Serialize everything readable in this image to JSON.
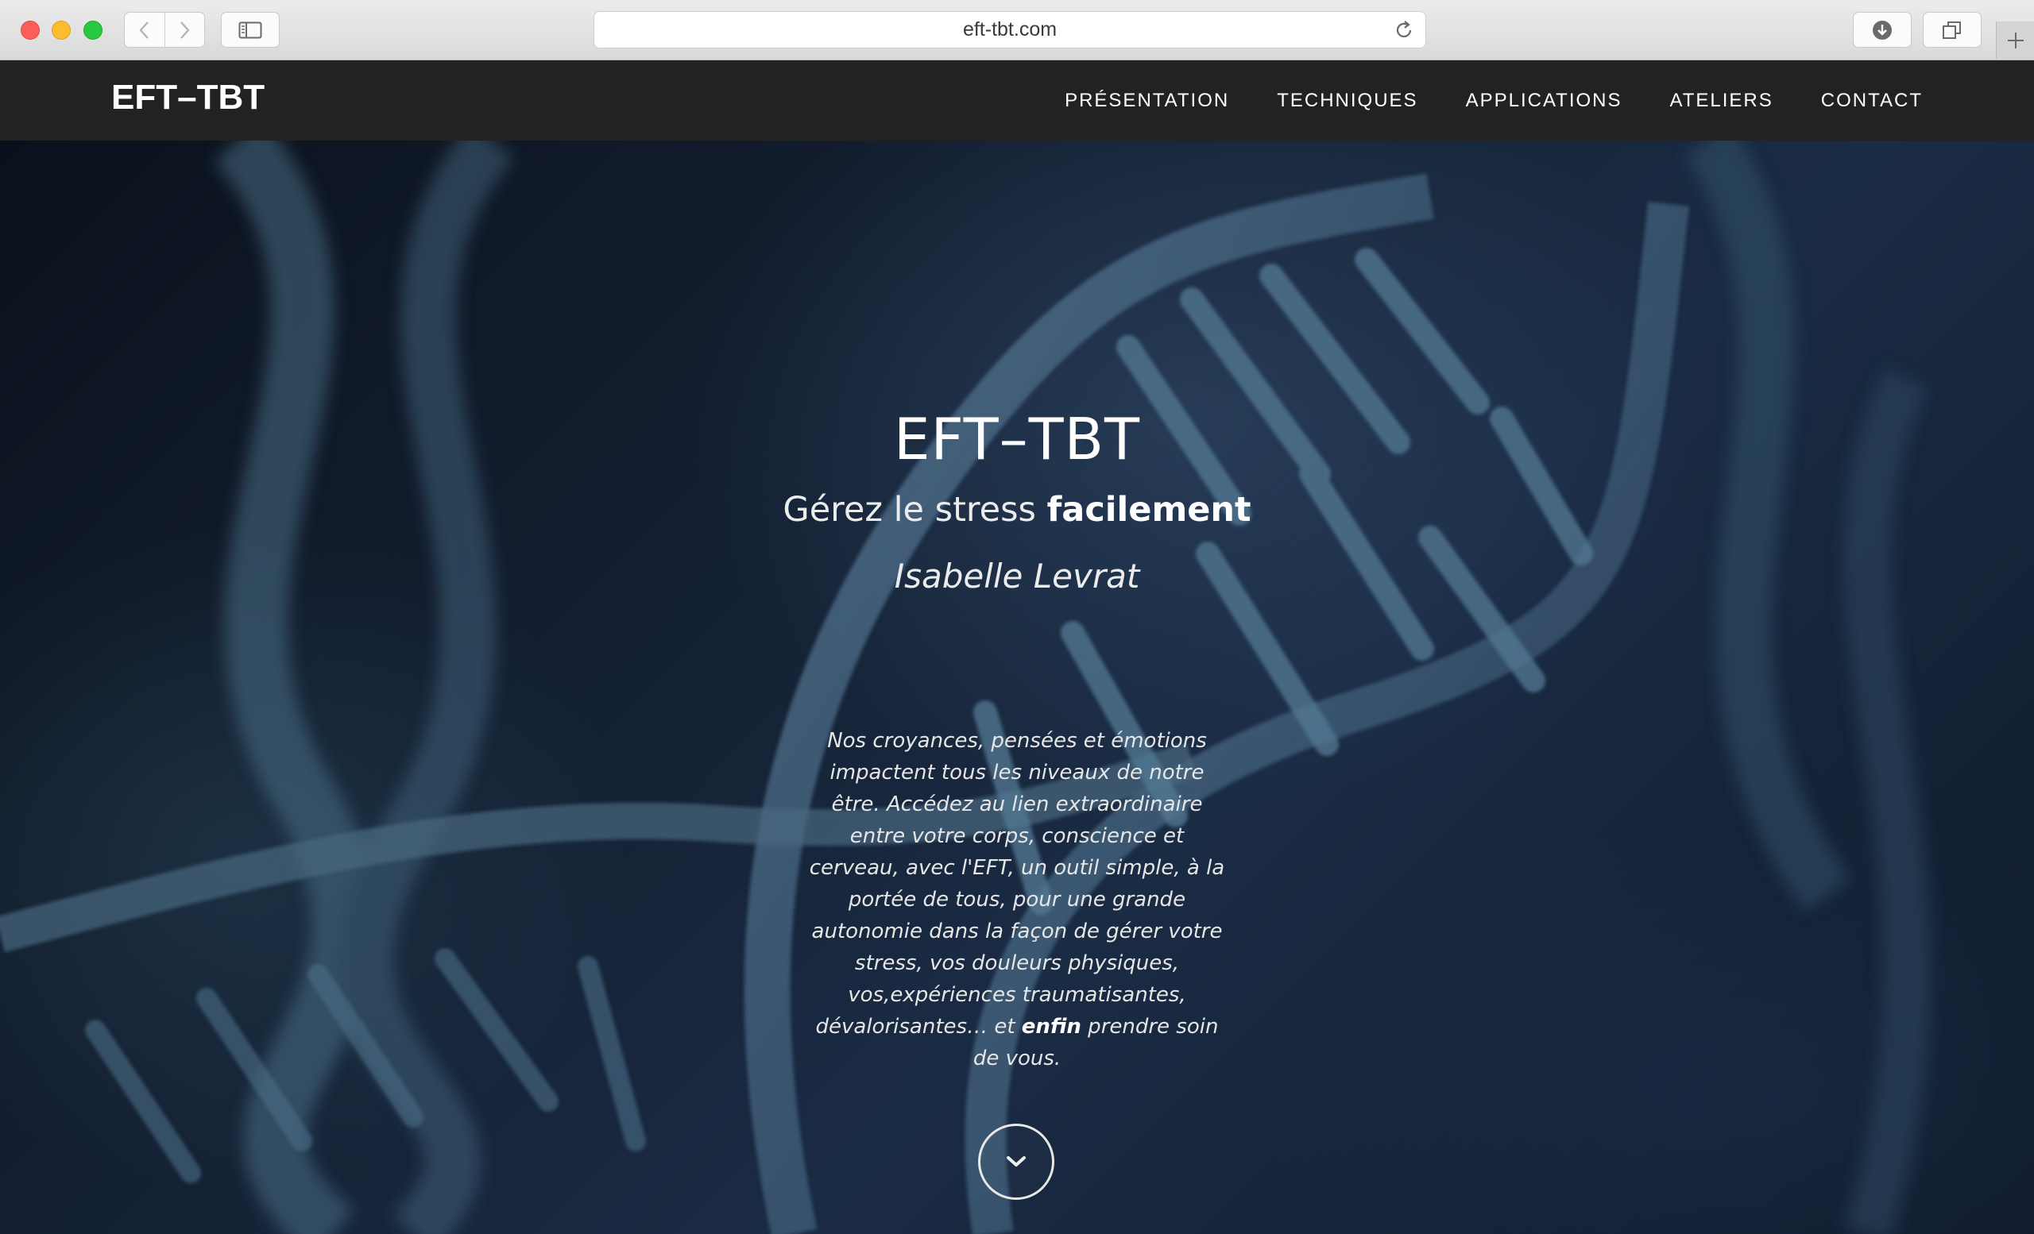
{
  "browser": {
    "url": "eft-tbt.com",
    "icons": {
      "back": "chevron-left-icon",
      "forward": "chevron-right-icon",
      "sidebar": "sidebar-icon",
      "reload": "reload-icon",
      "download": "download-icon",
      "tabs": "tabs-icon",
      "new_tab": "plus-icon"
    }
  },
  "site": {
    "brand": "EFT–TBT",
    "menu": [
      "PRÉSENTATION",
      "TECHNIQUES",
      "APPLICATIONS",
      "ATELIERS",
      "CONTACT"
    ]
  },
  "hero": {
    "title": "EFT–TBT",
    "subtitle_plain": "Gérez le stress ",
    "subtitle_bold": "facilement",
    "author": "Isabelle Levrat",
    "description_before": "Nos croyances, pensées et émotions impactent tous les niveaux de notre être. Accédez au lien extraordinaire entre votre corps, conscience et cerveau, avec l'EFT, un outil simple, à la portée de tous, pour une grande autonomie dans la façon de gérer votre stress, vos douleurs physiques, vos,expériences traumatisantes, dévalorisantes… et ",
    "description_bold": "enfin",
    "description_after": " prendre soin de vous.",
    "scroll_icon": "chevron-down-icon"
  },
  "colors": {
    "navbar_bg": "#222222",
    "nav_text": "#ffffff",
    "hero_bg": "#152235"
  }
}
